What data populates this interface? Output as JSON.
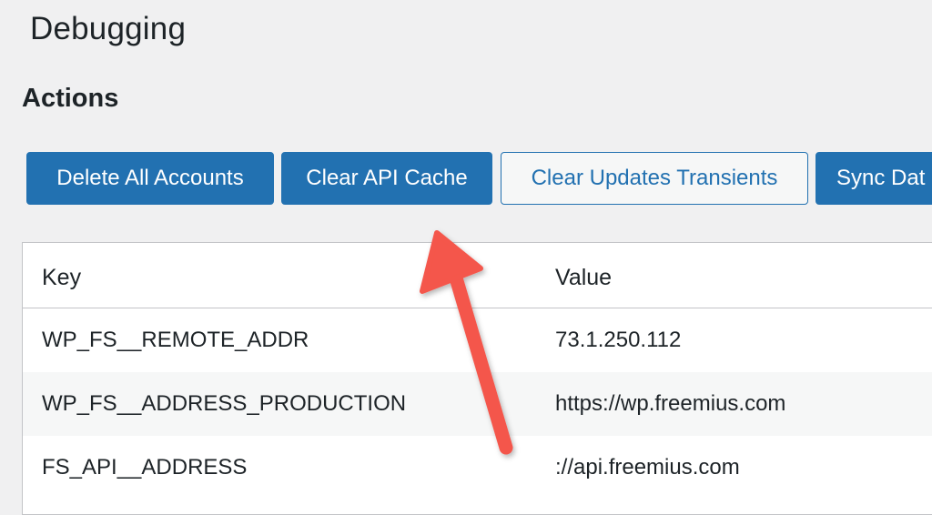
{
  "header": {
    "title": "Debugging"
  },
  "actions": {
    "title": "Actions",
    "buttons": [
      {
        "label": "Delete All Accounts",
        "style": "primary"
      },
      {
        "label": "Clear API Cache",
        "style": "primary"
      },
      {
        "label": "Clear Updates Transients",
        "style": "secondary"
      },
      {
        "label": "Sync Dat",
        "style": "primary"
      }
    ]
  },
  "table": {
    "columns": [
      "Key",
      "Value"
    ],
    "rows": [
      {
        "key": "WP_FS__REMOTE_ADDR",
        "value": "73.1.250.112"
      },
      {
        "key": "WP_FS__ADDRESS_PRODUCTION",
        "value": "https://wp.freemius.com"
      },
      {
        "key": "FS_API__ADDRESS",
        "value": "://api.freemius.com"
      }
    ]
  },
  "colors": {
    "primary": "#2271b1",
    "background": "#f0f0f1",
    "text": "#1d2327",
    "annotation_arrow": "#f4574b"
  }
}
